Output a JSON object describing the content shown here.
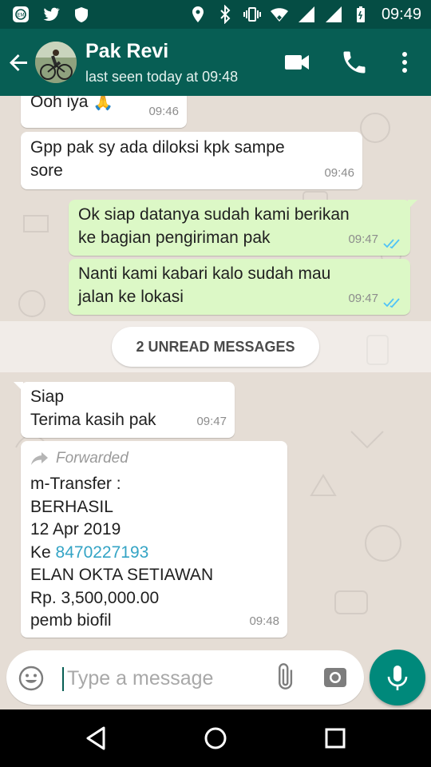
{
  "status_bar": {
    "time": "09:49",
    "left_icons": [
      "app-badge-icon",
      "twitter-icon",
      "shield-icon"
    ],
    "right_icons": [
      "location-icon",
      "bluetooth-icon",
      "vibrate-icon",
      "wifi-icon",
      "signal-icon",
      "signal-icon",
      "battery-icon"
    ]
  },
  "header": {
    "contact_name": "Pak Revi",
    "last_seen": "last seen today at 09:48",
    "color": "#075e54"
  },
  "messages": [
    {
      "direction": "in",
      "text": "Ooh iya 🙏",
      "time": "09:46"
    },
    {
      "direction": "in",
      "text": "Gpp pak sy ada diloksi kpk sampe\nsore",
      "time": "09:46"
    },
    {
      "direction": "out",
      "text": "Ok siap datanya sudah kami berikan\nke bagian pengiriman pak",
      "time": "09:47",
      "status": "read"
    },
    {
      "direction": "out",
      "text": "Nanti kami kabari kalo sudah mau\njalan ke lokasi",
      "time": "09:47",
      "status": "read"
    },
    {
      "direction": "in",
      "text": "Siap\nTerima kasih pak",
      "time": "09:47"
    }
  ],
  "unread_label": "2 UNREAD MESSAGES",
  "forwarded_message": {
    "forwarded_label": "Forwarded",
    "lines": [
      "m-Transfer :",
      "BERHASIL",
      "12 Apr 2019"
    ],
    "ke_prefix": "Ke ",
    "account_number": "8470227193",
    "lines_after": [
      "ELAN OKTA SETIAWAN",
      "Rp. 3,500,000.00",
      "pemb biofil"
    ],
    "time": "09:48"
  },
  "input": {
    "placeholder": "Type a message"
  },
  "colors": {
    "incoming_bubble": "#ffffff",
    "outgoing_bubble": "#dcf8c6",
    "chat_background": "#e5ddd5",
    "read_ticks": "#4fc3f7",
    "mic_button": "#00897b",
    "link": "#34a4c5"
  }
}
